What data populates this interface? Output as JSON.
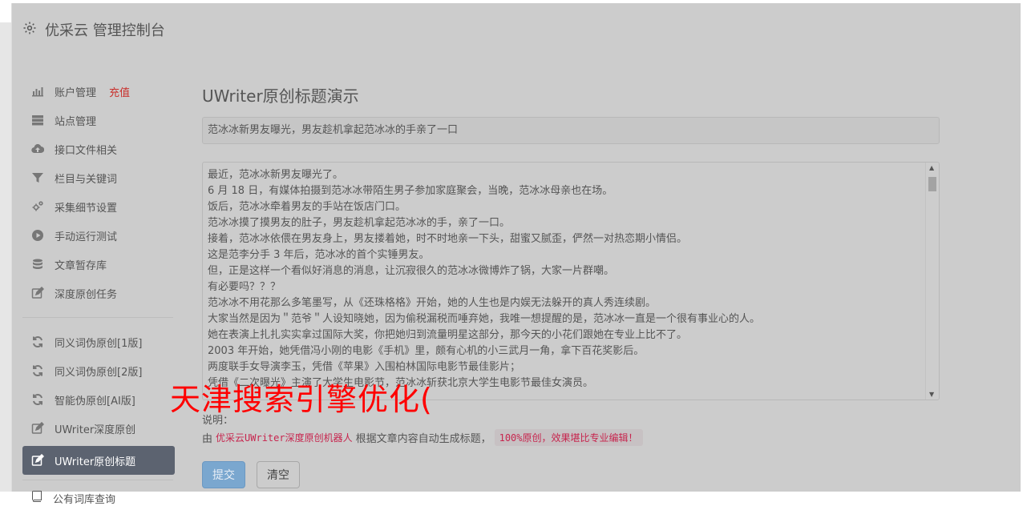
{
  "app": {
    "brand": "优采云 管理控制台",
    "icon": "gear-icon"
  },
  "sidebar": {
    "items": [
      {
        "label": "账户管理",
        "extra": "充值",
        "icon": "bar-chart-icon"
      },
      {
        "label": "站点管理",
        "icon": "server-icon"
      },
      {
        "label": "接口文件相关",
        "icon": "cloud-upload-icon"
      },
      {
        "label": "栏目与关键词",
        "icon": "filter-icon"
      },
      {
        "label": "采集细节设置",
        "icon": "cogs-icon"
      },
      {
        "label": "手动运行测试",
        "icon": "play-circle-icon"
      },
      {
        "label": "文章暂存库",
        "icon": "database-icon"
      },
      {
        "label": "深度原创任务",
        "icon": "edit-icon"
      }
    ],
    "items2": [
      {
        "label": "同义词伪原创[1版]",
        "icon": "refresh-icon"
      },
      {
        "label": "同义词伪原创[2版]",
        "icon": "refresh-icon"
      },
      {
        "label": "智能伪原创[AI版]",
        "icon": "refresh-icon"
      },
      {
        "label": "UWriter深度原创",
        "icon": "edit-icon"
      },
      {
        "label": "UWriter原创标题",
        "icon": "edit-icon",
        "active": true
      }
    ],
    "extra": {
      "label": "公有词库查询",
      "icon": "book-icon"
    }
  },
  "main": {
    "title": "UWriter原创标题演示",
    "title_value": "范冰冰新男友曝光，男友趁机拿起范冰冰的手亲了一口",
    "article_lines": [
      "最近，范冰冰新男友曝光了。",
      "6 月 18 日，有媒体拍摄到范冰冰带陌生男子参加家庭聚会，当晚，范冰冰母亲也在场。",
      "饭后，范冰冰牵着男友的手站在饭店门口。",
      "范冰冰摸了摸男友的肚子，男友趁机拿起范冰冰的手，亲了一口。",
      "接着，范冰冰依偎在男友身上，男友搂着她，时不时地亲一下头，甜蜜又腻歪，俨然一对热恋期小情侣。",
      "这是范李分手 3 年后，范冰冰的首个实锤男友。",
      "但，正是这样一个看似好消息的消息，让沉寂很久的范冰冰微博炸了锅，大家一片群嘲。",
      "有必要吗？？？",
      "范冰冰不用花那么多笔墨写，从《还珠格格》开始，她的人生也是内娱无法躲开的真人秀连续剧。",
      "大家当然是因为＂范爷＂人设知晓她，因为偷税漏税而唾弃她，我唯一想提醒的是，范冰冰一直是一个很有事业心的人。",
      "她在表演上扎扎实实拿过国际大奖，你把她归到流量明星这部分，那今天的小花们跟她在专业上比不了。",
      "2003 年开始，她凭借冯小刚的电影《手机》里，颇有心机的小三武月一角，拿下百花奖影后。",
      "两度联手女导演李玉，凭借《苹果》入围柏林国际电影节最佳影片；",
      "凭借《二次曝光》主演了大学生电影节，范冰冰斩获北京大学生电影节最佳女演员。"
    ],
    "desc_label": "说明：",
    "desc_prefix": "由",
    "desc_code": "优采云UWriter深度原创机器人",
    "desc_mid": "根据文章内容自动生成标题，",
    "desc_badge": "100%原创，效果堪比专业编辑！",
    "submit_label": "提交",
    "clear_label": "清空"
  },
  "watermark": "天津搜索引擎优化("
}
